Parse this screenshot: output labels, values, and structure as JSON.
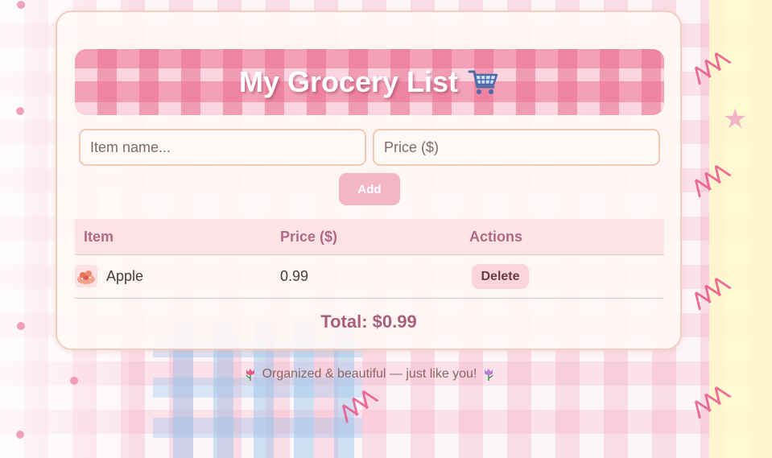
{
  "header": {
    "title": "My Grocery List",
    "title_icon": "shopping-cart-icon"
  },
  "form": {
    "item_placeholder": "Item name...",
    "item_value": "",
    "price_placeholder": "Price ($)",
    "price_value": "",
    "add_label": "Add"
  },
  "table": {
    "columns": [
      "Item",
      "Price ($)",
      "Actions"
    ],
    "rows": [
      {
        "icon": "food-sticker-icon",
        "item": "Apple",
        "price": "0.99",
        "action_label": "Delete"
      }
    ]
  },
  "summary": {
    "total_text": "Total: $0.99"
  },
  "footer": {
    "text": "Organized & beautiful — just like you!",
    "icon": "tulip-icon"
  },
  "colors": {
    "accent": "#f4b6c6",
    "heading": "#b06a85",
    "total": "#a86079",
    "border": "#f0c8b3"
  }
}
